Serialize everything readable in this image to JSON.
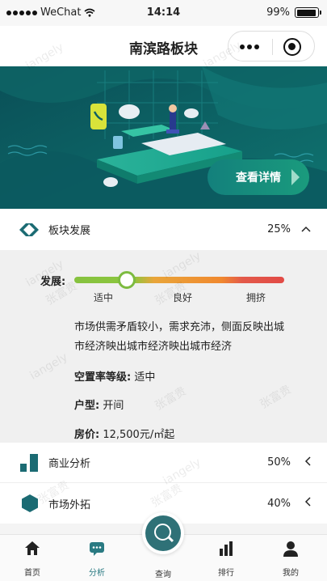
{
  "status_bar": {
    "carrier": "WeChat",
    "time": "14:14",
    "battery": "99%"
  },
  "nav": {
    "title": "南滨路板块"
  },
  "banner": {
    "cta_label": "查看详情"
  },
  "sections": [
    {
      "label": "板块发展",
      "percent": "25%",
      "expanded": true
    },
    {
      "label": "商业分析",
      "percent": "50%",
      "expanded": false
    },
    {
      "label": "市场外拓",
      "percent": "40%",
      "expanded": false
    }
  ],
  "development": {
    "label": "发展:",
    "level_fraction": 0.25,
    "scale_labels": [
      "适中",
      "良好",
      "拥挤"
    ],
    "description": "市场供需矛盾较小，需求充沛，侧面反映出城市经济映出城市经济映出城市经济",
    "vacancy_label": "空置率等级:",
    "vacancy_value": "适中",
    "type_label": "户型:",
    "type_value": "开间",
    "price_label": "房价:",
    "price_value": "12,500元/㎡起"
  },
  "watermarks": [
    "iangely",
    "张富贵"
  ],
  "tabbar": {
    "items": [
      {
        "label": "首页",
        "icon": "home-icon"
      },
      {
        "label": "分析",
        "icon": "chat-icon",
        "active": true
      },
      {
        "label": "查询",
        "icon": "search-icon"
      },
      {
        "label": "排行",
        "icon": "bar-chart-icon"
      },
      {
        "label": "我的",
        "icon": "user-icon"
      }
    ]
  },
  "colors": {
    "accent": "#2a7a82",
    "banner_bg": "#0d5e63",
    "level_good": "#8cc63e",
    "level_mid": "#f0892f",
    "level_bad": "#e24a46"
  }
}
